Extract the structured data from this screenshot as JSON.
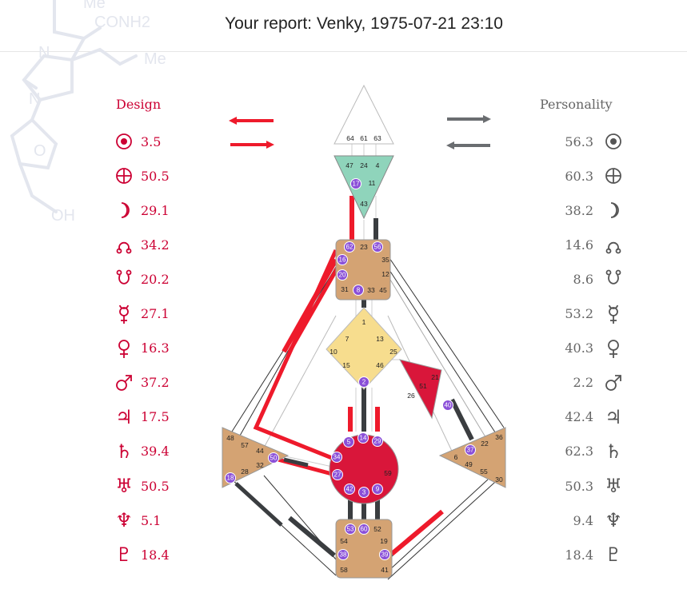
{
  "header": {
    "title": "Your report: Venky, 1975-07-21 23:10"
  },
  "watermark": {
    "labels": [
      "Me",
      "CONH2",
      "Me",
      "N",
      "N",
      "O",
      "OH"
    ]
  },
  "colors": {
    "design": "#cc0033",
    "personality": "#555555",
    "defined_channel": "#ee1a2b",
    "personality_channel": "#3a3d40",
    "active_gate": "#8a4fd8"
  },
  "design": {
    "title": "Design",
    "rows": [
      {
        "planet": "sun-icon",
        "value": "3.5"
      },
      {
        "planet": "earth-icon",
        "value": "50.5"
      },
      {
        "planet": "moon-icon",
        "value": "29.1"
      },
      {
        "planet": "north-node-icon",
        "value": "34.2"
      },
      {
        "planet": "south-node-icon",
        "value": "20.2"
      },
      {
        "planet": "mercury-icon",
        "value": "27.1"
      },
      {
        "planet": "venus-icon",
        "value": "16.3"
      },
      {
        "planet": "mars-icon",
        "value": "37.2"
      },
      {
        "planet": "jupiter-icon",
        "value": "17.5"
      },
      {
        "planet": "saturn-icon",
        "value": "39.4"
      },
      {
        "planet": "uranus-icon",
        "value": "50.5"
      },
      {
        "planet": "neptune-icon",
        "value": "5.1"
      },
      {
        "planet": "pluto-icon",
        "value": "18.4"
      }
    ]
  },
  "personality": {
    "title": "Personality",
    "rows": [
      {
        "planet": "sun-icon",
        "value": "56.3"
      },
      {
        "planet": "earth-icon",
        "value": "60.3"
      },
      {
        "planet": "moon-icon",
        "value": "38.2"
      },
      {
        "planet": "north-node-icon",
        "value": "14.6"
      },
      {
        "planet": "south-node-icon",
        "value": "8.6"
      },
      {
        "planet": "mercury-icon",
        "value": "53.2"
      },
      {
        "planet": "venus-icon",
        "value": "40.3"
      },
      {
        "planet": "mars-icon",
        "value": "2.2"
      },
      {
        "planet": "jupiter-icon",
        "value": "42.4"
      },
      {
        "planet": "saturn-icon",
        "value": "62.3"
      },
      {
        "planet": "uranus-icon",
        "value": "50.3"
      },
      {
        "planet": "neptune-icon",
        "value": "9.4"
      },
      {
        "planet": "pluto-icon",
        "value": "18.4"
      }
    ]
  },
  "bodygraph": {
    "centers": {
      "head": {
        "gates": [
          "64",
          "61",
          "63"
        ]
      },
      "ajna": {
        "gates": [
          "47",
          "24",
          "4",
          "17",
          "11",
          "43"
        ],
        "active": [
          "17"
        ]
      },
      "throat": {
        "gates": [
          "62",
          "23",
          "56",
          "16",
          "35",
          "12",
          "20",
          "31",
          "8",
          "33",
          "45"
        ],
        "active": [
          "62",
          "56",
          "16",
          "20",
          "8"
        ]
      },
      "g": {
        "gates": [
          "1",
          "7",
          "13",
          "10",
          "25",
          "15",
          "46",
          "2"
        ],
        "active": [
          "2"
        ]
      },
      "ego": {
        "gates": [
          "21",
          "51",
          "26",
          "40"
        ],
        "active": [
          "40"
        ]
      },
      "sacral": {
        "gates": [
          "5",
          "14",
          "29",
          "34",
          "59",
          "27",
          "42",
          "3",
          "9"
        ],
        "active": [
          "5",
          "14",
          "29",
          "34",
          "27",
          "42",
          "3",
          "9"
        ]
      },
      "spleen": {
        "gates": [
          "48",
          "57",
          "44",
          "32",
          "50",
          "28",
          "18"
        ],
        "active": [
          "50",
          "18"
        ]
      },
      "solar_plexus": {
        "gates": [
          "36",
          "22",
          "37",
          "6",
          "49",
          "55",
          "30"
        ],
        "active": [
          "37"
        ]
      },
      "root": {
        "gates": [
          "53",
          "60",
          "52",
          "54",
          "19",
          "38",
          "39",
          "58",
          "41"
        ],
        "active": [
          "53",
          "60",
          "38",
          "39"
        ]
      }
    }
  }
}
